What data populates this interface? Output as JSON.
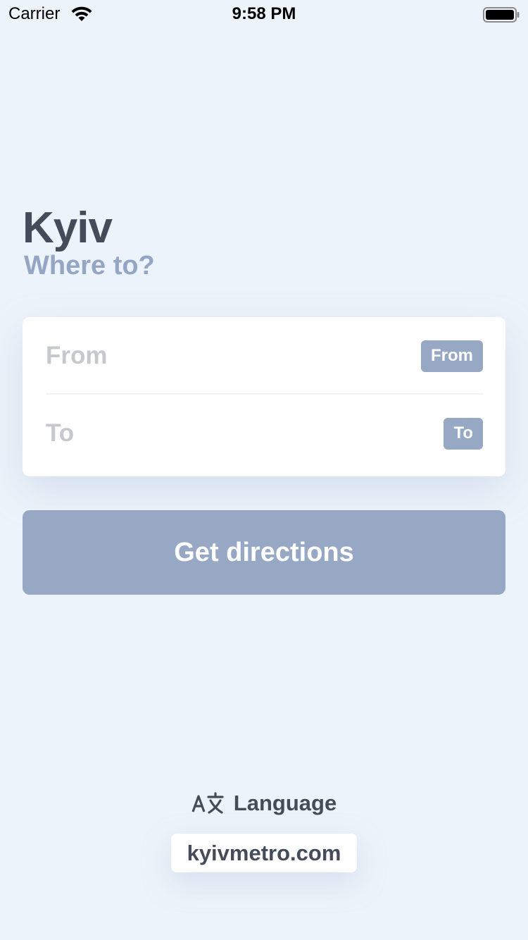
{
  "status_bar": {
    "carrier": "Carrier",
    "time": "9:58 PM"
  },
  "header": {
    "city": "Kyiv",
    "subtitle": "Where to?"
  },
  "route": {
    "from_placeholder": "From",
    "from_badge": "From",
    "to_placeholder": "To",
    "to_badge": "To"
  },
  "directions_button": "Get directions",
  "footer": {
    "language_label": "Language",
    "site_link": "kyivmetro.com"
  },
  "colors": {
    "background": "#edf3fa",
    "title": "#454b58",
    "accent": "#97a8c5",
    "placeholder": "#c6c8cc"
  },
  "icons": [
    "wifi-icon",
    "battery-icon",
    "translate-icon"
  ]
}
